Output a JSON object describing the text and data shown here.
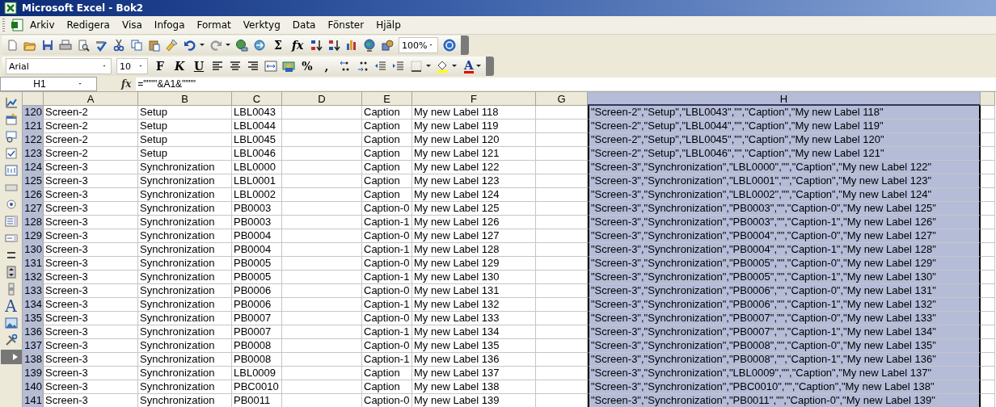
{
  "window": {
    "title": "Microsoft Excel - Bok2"
  },
  "menu": [
    "Arkiv",
    "Redigera",
    "Visa",
    "Infoga",
    "Format",
    "Verktyg",
    "Data",
    "Fönster",
    "Hjälp"
  ],
  "standard_toolbar": {
    "sum": "Σ",
    "function": "fx",
    "zoom": "100%"
  },
  "formatting_toolbar": {
    "font": "Arial",
    "size": "10",
    "bold": "F",
    "italic": "K",
    "underline": "U",
    "percent": "%",
    "comma": ",",
    "font_color": "A"
  },
  "drawing_toolbar": {
    "label_tool": "A"
  },
  "formula_bar": {
    "name_box": "H1",
    "fx": "fx",
    "formula": "=\"\"\"\"&A1&\"\"\"\""
  },
  "columns": [
    {
      "label": "A",
      "selected": false
    },
    {
      "label": "B",
      "selected": false
    },
    {
      "label": "C",
      "selected": false
    },
    {
      "label": "D",
      "selected": false
    },
    {
      "label": "E",
      "selected": false
    },
    {
      "label": "F",
      "selected": false
    },
    {
      "label": "G",
      "selected": false
    },
    {
      "label": "H",
      "selected": true
    }
  ],
  "rows": [
    {
      "number": "120",
      "cells": [
        "Screen-2",
        "Setup",
        "LBL0043",
        "",
        "Caption",
        "My new Label 118",
        "",
        "\"Screen-2\",\"Setup\",\"LBL0043\",\"\",\"Caption\",\"My new Label 118\""
      ]
    },
    {
      "number": "121",
      "cells": [
        "Screen-2",
        "Setup",
        "LBL0044",
        "",
        "Caption",
        "My new Label 119",
        "",
        "\"Screen-2\",\"Setup\",\"LBL0044\",\"\",\"Caption\",\"My new Label 119\""
      ]
    },
    {
      "number": "122",
      "cells": [
        "Screen-2",
        "Setup",
        "LBL0045",
        "",
        "Caption",
        "My new Label 120",
        "",
        "\"Screen-2\",\"Setup\",\"LBL0045\",\"\",\"Caption\",\"My new Label 120\""
      ]
    },
    {
      "number": "123",
      "cells": [
        "Screen-2",
        "Setup",
        "LBL0046",
        "",
        "Caption",
        "My new Label 121",
        "",
        "\"Screen-2\",\"Setup\",\"LBL0046\",\"\",\"Caption\",\"My new Label 121\""
      ]
    },
    {
      "number": "124",
      "cells": [
        "Screen-3",
        "Synchronization",
        "LBL0000",
        "",
        "Caption",
        "My new Label 122",
        "",
        "\"Screen-3\",\"Synchronization\",\"LBL0000\",\"\",\"Caption\",\"My new Label 122\""
      ]
    },
    {
      "number": "125",
      "cells": [
        "Screen-3",
        "Synchronization",
        "LBL0001",
        "",
        "Caption",
        "My new Label 123",
        "",
        "\"Screen-3\",\"Synchronization\",\"LBL0001\",\"\",\"Caption\",\"My new Label 123\""
      ]
    },
    {
      "number": "126",
      "cells": [
        "Screen-3",
        "Synchronization",
        "LBL0002",
        "",
        "Caption",
        "My new Label 124",
        "",
        "\"Screen-3\",\"Synchronization\",\"LBL0002\",\"\",\"Caption\",\"My new Label 124\""
      ]
    },
    {
      "number": "127",
      "cells": [
        "Screen-3",
        "Synchronization",
        "PB0003",
        "",
        "Caption-0",
        "My new Label 125",
        "",
        "\"Screen-3\",\"Synchronization\",\"PB0003\",\"\",\"Caption-0\",\"My new Label 125\""
      ]
    },
    {
      "number": "128",
      "cells": [
        "Screen-3",
        "Synchronization",
        "PB0003",
        "",
        "Caption-1",
        "My new Label 126",
        "",
        "\"Screen-3\",\"Synchronization\",\"PB0003\",\"\",\"Caption-1\",\"My new Label 126\""
      ]
    },
    {
      "number": "129",
      "cells": [
        "Screen-3",
        "Synchronization",
        "PB0004",
        "",
        "Caption-0",
        "My new Label 127",
        "",
        "\"Screen-3\",\"Synchronization\",\"PB0004\",\"\",\"Caption-0\",\"My new Label 127\""
      ]
    },
    {
      "number": "130",
      "cells": [
        "Screen-3",
        "Synchronization",
        "PB0004",
        "",
        "Caption-1",
        "My new Label 128",
        "",
        "\"Screen-3\",\"Synchronization\",\"PB0004\",\"\",\"Caption-1\",\"My new Label 128\""
      ]
    },
    {
      "number": "131",
      "cells": [
        "Screen-3",
        "Synchronization",
        "PB0005",
        "",
        "Caption-0",
        "My new Label 129",
        "",
        "\"Screen-3\",\"Synchronization\",\"PB0005\",\"\",\"Caption-0\",\"My new Label 129\""
      ]
    },
    {
      "number": "132",
      "cells": [
        "Screen-3",
        "Synchronization",
        "PB0005",
        "",
        "Caption-1",
        "My new Label 130",
        "",
        "\"Screen-3\",\"Synchronization\",\"PB0005\",\"\",\"Caption-1\",\"My new Label 130\""
      ]
    },
    {
      "number": "133",
      "cells": [
        "Screen-3",
        "Synchronization",
        "PB0006",
        "",
        "Caption-0",
        "My new Label 131",
        "",
        "\"Screen-3\",\"Synchronization\",\"PB0006\",\"\",\"Caption-0\",\"My new Label 131\""
      ]
    },
    {
      "number": "134",
      "cells": [
        "Screen-3",
        "Synchronization",
        "PB0006",
        "",
        "Caption-1",
        "My new Label 132",
        "",
        "\"Screen-3\",\"Synchronization\",\"PB0006\",\"\",\"Caption-1\",\"My new Label 132\""
      ]
    },
    {
      "number": "135",
      "cells": [
        "Screen-3",
        "Synchronization",
        "PB0007",
        "",
        "Caption-0",
        "My new Label 133",
        "",
        "\"Screen-3\",\"Synchronization\",\"PB0007\",\"\",\"Caption-0\",\"My new Label 133\""
      ]
    },
    {
      "number": "136",
      "cells": [
        "Screen-3",
        "Synchronization",
        "PB0007",
        "",
        "Caption-1",
        "My new Label 134",
        "",
        "\"Screen-3\",\"Synchronization\",\"PB0007\",\"\",\"Caption-1\",\"My new Label 134\""
      ]
    },
    {
      "number": "137",
      "cells": [
        "Screen-3",
        "Synchronization",
        "PB0008",
        "",
        "Caption-0",
        "My new Label 135",
        "",
        "\"Screen-3\",\"Synchronization\",\"PB0008\",\"\",\"Caption-0\",\"My new Label 135\""
      ]
    },
    {
      "number": "138",
      "cells": [
        "Screen-3",
        "Synchronization",
        "PB0008",
        "",
        "Caption-1",
        "My new Label 136",
        "",
        "\"Screen-3\",\"Synchronization\",\"PB0008\",\"\",\"Caption-1\",\"My new Label 136\""
      ]
    },
    {
      "number": "139",
      "cells": [
        "Screen-3",
        "Synchronization",
        "LBL0009",
        "",
        "Caption",
        "My new Label 137",
        "",
        "\"Screen-3\",\"Synchronization\",\"LBL0009\",\"\",\"Caption\",\"My new Label 137\""
      ]
    },
    {
      "number": "140",
      "cells": [
        "Screen-3",
        "Synchronization",
        "PBC0010",
        "",
        "Caption",
        "My new Label 138",
        "",
        "\"Screen-3\",\"Synchronization\",\"PBC0010\",\"\",\"Caption\",\"My new Label 138\""
      ]
    },
    {
      "number": "141",
      "cells": [
        "Screen-3",
        "Synchronization",
        "PB0011",
        "",
        "Caption-0",
        "My new Label 139",
        "",
        "\"Screen-3\",\"Synchronization\",\"PB0011\",\"\",\"Caption-0\",\"My new Label 139\""
      ]
    }
  ]
}
